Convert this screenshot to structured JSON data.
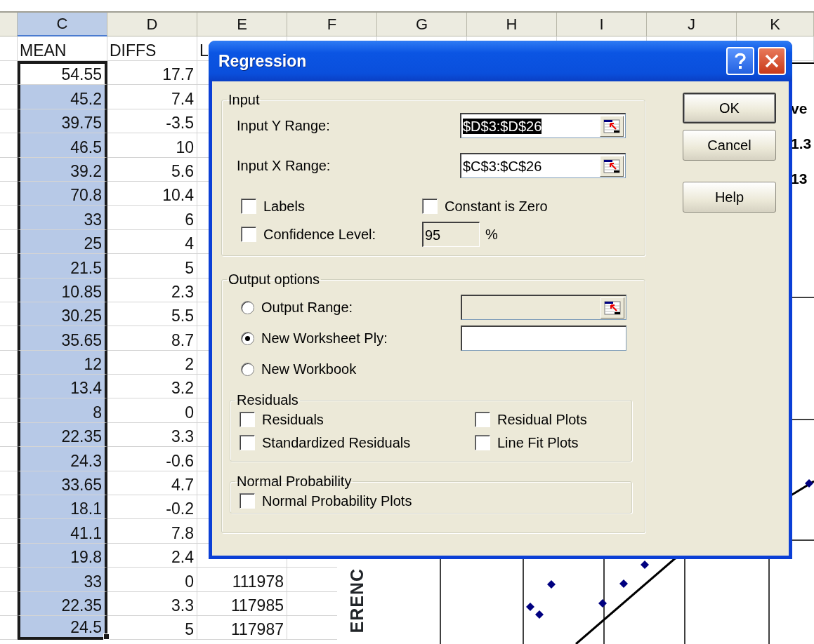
{
  "sheet": {
    "columns": [
      {
        "letter": "C",
        "selected": true
      },
      {
        "letter": "D",
        "selected": false
      },
      {
        "letter": "E",
        "selected": false
      },
      {
        "letter": "F",
        "selected": false
      },
      {
        "letter": "G",
        "selected": false
      },
      {
        "letter": "H",
        "selected": false
      },
      {
        "letter": "I",
        "selected": false
      },
      {
        "letter": "J",
        "selected": false
      },
      {
        "letter": "K",
        "selected": false
      }
    ],
    "header_row": {
      "c": "MEAN",
      "d": "DIFFS",
      "e": "L"
    },
    "rows": [
      {
        "c": "54.55",
        "d": "17.7",
        "selected": true,
        "active": true
      },
      {
        "c": "45.2",
        "d": "7.4",
        "selected": true,
        "active": false
      },
      {
        "c": "39.75",
        "d": "-3.5",
        "selected": true,
        "active": false
      },
      {
        "c": "46.5",
        "d": "10",
        "selected": true,
        "active": false
      },
      {
        "c": "39.2",
        "d": "5.6",
        "selected": true,
        "active": false
      },
      {
        "c": "70.8",
        "d": "10.4",
        "selected": true,
        "active": false
      },
      {
        "c": "33",
        "d": "6",
        "selected": true,
        "active": false
      },
      {
        "c": "25",
        "d": "4",
        "selected": true,
        "active": false
      },
      {
        "c": "21.5",
        "d": "5",
        "selected": true,
        "active": false
      },
      {
        "c": "10.85",
        "d": "2.3",
        "selected": true,
        "active": false
      },
      {
        "c": "30.25",
        "d": "5.5",
        "selected": true,
        "active": false
      },
      {
        "c": "35.65",
        "d": "8.7",
        "selected": true,
        "active": false
      },
      {
        "c": "12",
        "d": "2",
        "selected": true,
        "active": false
      },
      {
        "c": "13.4",
        "d": "3.2",
        "selected": true,
        "active": false
      },
      {
        "c": "8",
        "d": "0",
        "selected": true,
        "active": false
      },
      {
        "c": "22.35",
        "d": "3.3",
        "selected": true,
        "active": false
      },
      {
        "c": "24.3",
        "d": "-0.6",
        "selected": true,
        "active": false
      },
      {
        "c": "33.65",
        "d": "4.7",
        "selected": true,
        "active": false
      },
      {
        "c": "18.1",
        "d": "-0.2",
        "selected": true,
        "active": false
      },
      {
        "c": "41.1",
        "d": "7.8",
        "selected": true,
        "active": false
      },
      {
        "c": "19.8",
        "d": "2.4",
        "selected": true,
        "active": false
      },
      {
        "c": "33",
        "d": "0",
        "e": "111978",
        "selected": true,
        "active": false
      },
      {
        "c": "22.35",
        "d": "3.3",
        "e": "117985",
        "selected": true,
        "active": false
      },
      {
        "c": "24.5",
        "d": "5",
        "e": "117987",
        "selected": true,
        "active": false
      }
    ]
  },
  "chart": {
    "side_labels": [
      "ve",
      "1.3",
      "13"
    ],
    "axis_title": "ERENC"
  },
  "dialog": {
    "title": "Regression",
    "input": {
      "legend": "Input",
      "ranges": [
        {
          "label": "Input Y Range:",
          "value": "$D$3:$D$26",
          "selected": true
        },
        {
          "label": "Input X Range:",
          "value": "$C$3:$C$26",
          "selected": false
        }
      ],
      "labels": {
        "label": "Labels",
        "checked": false
      },
      "constant_zero": {
        "label": "Constant is Zero",
        "checked": false
      },
      "confidence": {
        "label": "Confidence Level:",
        "checked": false,
        "value": "95",
        "disabled": true,
        "unit": "%"
      }
    },
    "output": {
      "legend": "Output options",
      "options": [
        {
          "label": "Output Range:",
          "selected": false,
          "field": {
            "kind": "range",
            "disabled": true
          }
        },
        {
          "label": "New Worksheet Ply:",
          "selected": true,
          "field": {
            "kind": "text",
            "disabled": false
          }
        },
        {
          "label": "New Workbook",
          "selected": false
        }
      ],
      "residuals": {
        "legend": "Residuals",
        "items": [
          {
            "label": "Residuals",
            "checked": false
          },
          {
            "label": "Residual Plots",
            "checked": false
          },
          {
            "label": "Standardized Residuals",
            "checked": false
          },
          {
            "label": "Line Fit Plots",
            "checked": false
          }
        ]
      },
      "normal": {
        "legend": "Normal Probability",
        "items": [
          {
            "label": "Normal Probability Plots",
            "checked": false
          }
        ]
      }
    },
    "buttons": [
      {
        "label": "OK",
        "default": true
      },
      {
        "label": "Cancel",
        "default": false
      },
      {
        "label": "Help",
        "default": false
      }
    ]
  }
}
